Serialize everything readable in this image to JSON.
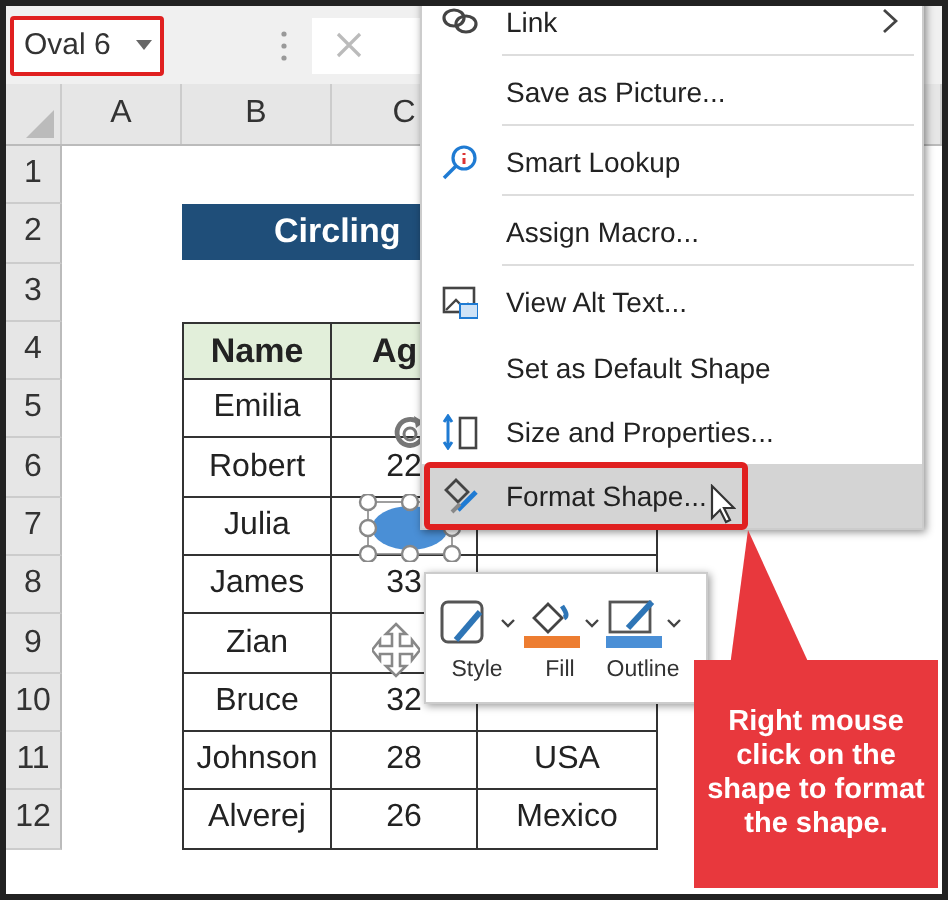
{
  "name_box": {
    "value": "Oval 6"
  },
  "sheet": {
    "column_headers": [
      "A",
      "B",
      "C"
    ],
    "row_headers": [
      "1",
      "2",
      "3",
      "4",
      "5",
      "6",
      "7",
      "8",
      "9",
      "10",
      "11",
      "12"
    ],
    "title": "Circling",
    "table": {
      "header": [
        "Name",
        "Ag"
      ],
      "rows": [
        [
          "Emilia"
        ],
        [
          "Robert",
          "22"
        ],
        [
          "Julia"
        ],
        [
          "James",
          "33"
        ],
        [
          "Zian"
        ],
        [
          "Bruce",
          "32"
        ],
        [
          "Johnson",
          "28",
          "USA"
        ],
        [
          "Alverej",
          "26",
          "Mexico"
        ]
      ]
    }
  },
  "context_menu": {
    "items": [
      {
        "label": "Link",
        "kind": "link",
        "submenu": true,
        "separator": true,
        "selected": false
      },
      {
        "label": "Save as Picture...",
        "kind": "none",
        "submenu": false,
        "separator": true,
        "selected": false
      },
      {
        "label": "Smart Lookup",
        "kind": "lookup",
        "submenu": false,
        "separator": true,
        "selected": false
      },
      {
        "label": "Assign Macro...",
        "kind": "none",
        "submenu": false,
        "separator": true,
        "selected": false
      },
      {
        "label": "View Alt Text...",
        "kind": "alt",
        "submenu": false,
        "separator": false,
        "selected": false
      },
      {
        "label": "Set as Default Shape",
        "kind": "none",
        "submenu": false,
        "separator": false,
        "selected": false
      },
      {
        "label": "Size and Properties...",
        "kind": "size",
        "submenu": false,
        "separator": false,
        "selected": false
      },
      {
        "label": "Format Shape...",
        "kind": "format",
        "submenu": false,
        "separator": false,
        "selected": true
      }
    ]
  },
  "mini_toolbar": {
    "buttons": [
      {
        "label": "Style",
        "kind": "style"
      },
      {
        "label": "Fill",
        "kind": "fill",
        "color": "#ed7d31"
      },
      {
        "label": "Outline",
        "kind": "outline",
        "color": "#4a8fd6"
      }
    ]
  },
  "callout": {
    "text": "Right mouse click on the shape to format the shape."
  }
}
